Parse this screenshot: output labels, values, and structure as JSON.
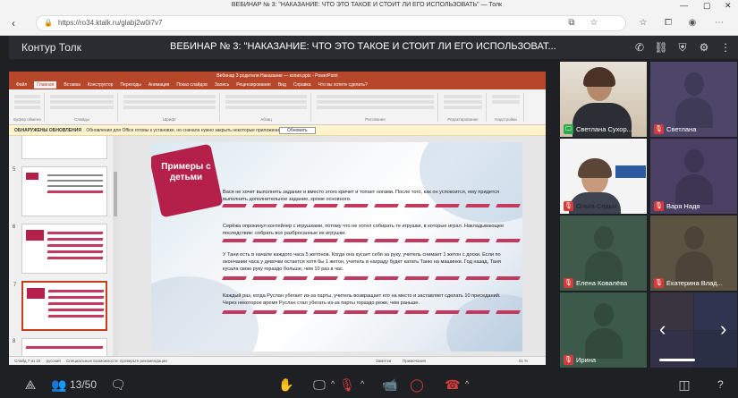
{
  "browser": {
    "tab_title": "ВЕБИНАР № 3: \"НАКАЗАНИЕ: ЧТО ЭТО ТАКОЕ И СТОИТ ЛИ ЕГО ИСПОЛЬЗОВАТЬ\" — Толк",
    "url": "https://ro34.ktalk.ru/glabj2w0i7v7"
  },
  "app": {
    "brand": "Контур Толк",
    "title": "ВЕБИНАР № 3: \"НАКАЗАНИЕ: ЧТО ЭТО ТАКОЕ И СТОИТ ЛИ ЕГО ИСПОЛЬЗОВАТ..."
  },
  "powerpoint": {
    "window_title": "Вебинар 3 родители Наказание — копия.pptx - PowerPoint",
    "tabs": [
      "Файл",
      "Главная",
      "Вставка",
      "Конструктор",
      "Переходы",
      "Анимация",
      "Показ слайдов",
      "Запись",
      "Рецензирование",
      "Вид",
      "Справка",
      "Что вы хотите сделать?"
    ],
    "active_tab_index": 1,
    "ribbon_groups": [
      "Буфер обмена",
      "Слайды",
      "Шрифт",
      "Абзац",
      "Рисование",
      "Редактирование",
      "Надстройки"
    ],
    "infobar_title": "ОБНАРУЖЕНЫ ОБНОВЛЕНИЯ",
    "infobar_text": "Обновления для Office готовы к установке, но сначала нужно закрыть некоторые приложения.",
    "infobar_button": "Обновить",
    "thumbnail_numbers": [
      "5",
      "6",
      "7",
      "8"
    ],
    "status_left": "Слайд 7 из 15",
    "status_lang": "русский",
    "status_access": "Специальные возможности: проверьте рекомендации",
    "status_notes": "Заметки",
    "status_comments": "Примечания",
    "status_zoom": "81 %"
  },
  "slide": {
    "badge": "Примеры с детьми",
    "paragraphs": [
      "Вася не хочет выполнять задание и вместо этого кричит и топает ногами. После того, как он успокоится, ему придется выполнить дополнительное задание, кроме основного.",
      "Серёжа опрокинул контейнер с игрушками, потому что не хотел собирать те игрушки, в которые играл. Накладывающее последствие: собрать все разбросанные их игрушки.",
      "У Тани есть в начале каждого часа 5 жетонов. Когда она кусает себя за руку, учитель снимает 1 жетон с доски. Если по окончании часа у девочки остается хотя бы 1 жетон, учитель в награду будет катать Таню на машинке. Год назад, Таня кусала свою руку гораздо больше, чем 10 раз в час.",
      "Каждый раз, когда Руслан убегает из-за парты, учитель возвращает его на место и заставляет сделать 10 приседаний. Через некоторое время Руслан стал убегать из-за парты гораздо реже, чем раньше."
    ]
  },
  "participants": [
    {
      "name": "Светлана Сухор...",
      "muted": false,
      "video": true,
      "active": true
    },
    {
      "name": "Светлана",
      "muted": true,
      "video": false,
      "active": false
    },
    {
      "name": "Ольга Седых",
      "muted": true,
      "video": true,
      "active": false
    },
    {
      "name": "Варя Надя",
      "muted": true,
      "video": false,
      "active": false
    },
    {
      "name": "Елена Ковалёва",
      "muted": true,
      "video": false,
      "active": false
    },
    {
      "name": "Екатерина Влад...",
      "muted": true,
      "video": false,
      "active": false
    },
    {
      "name": "Ирина",
      "muted": true,
      "video": false,
      "active": false
    }
  ],
  "toolbar": {
    "participants_count": "13/50",
    "help": "?"
  }
}
